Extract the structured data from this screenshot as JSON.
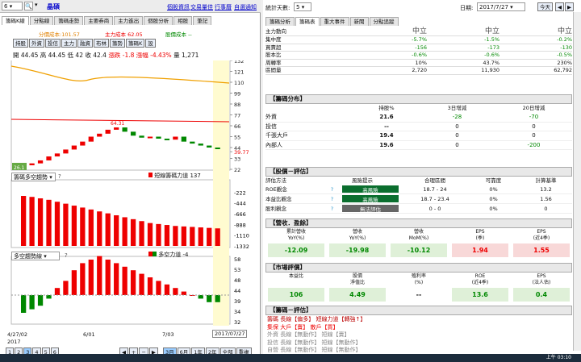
{
  "left": {
    "stock_code": "6",
    "stock_name": "晶碩",
    "links": [
      "個股資訊",
      "交易量佳",
      "行事曆",
      "自選通知"
    ],
    "tabs": [
      "籌碼K線",
      "分點線",
      "籌碼走勢",
      "主要券商",
      "主力進出",
      "個股分析",
      "相股",
      "筆記"
    ],
    "ma_labels": {
      "a": "分價成本:101.57",
      "b": "主力成本 62.05",
      "c": "股價成本 --"
    },
    "buttons": [
      "持股",
      "外資",
      "投信",
      "主力",
      "融資",
      "布林",
      "籌勢",
      "籌碼K",
      "設"
    ],
    "ohlc": {
      "open_label": "開",
      "open": "44.45",
      "high_label": "高",
      "high": "44.45",
      "low_label": "低",
      "low": "42",
      "close_label": "收",
      "close": "42.4",
      "chg_label": "漲跌",
      "chg": "-1.8",
      "pct_label": "漲幅",
      "pct": "-4.43%",
      "vol_label": "量",
      "vol": "1,271"
    },
    "price_axis": [
      "132",
      "121",
      "110",
      "99",
      "88",
      "77",
      "66",
      "55",
      "44",
      "39.77",
      "33",
      "22"
    ],
    "peak_label": "64.31",
    "low_label": "26.1",
    "panel2_select": "籌碼多空趨勢",
    "panel2_legend": "短線籌碼力道 137",
    "panel2_axis": [
      "-222",
      "-444",
      "-666",
      "-888",
      "-1110",
      "-1332"
    ],
    "panel3_select": "多空趨勢線",
    "panel3_legend": "多空力道 -4",
    "panel3_axis": [
      "58",
      "53",
      "48",
      "44",
      "39",
      "34",
      "32"
    ],
    "x_labels": [
      "4/27/02",
      "6/01",
      "7/03",
      "2017/07/27"
    ],
    "year": "2017",
    "pages": [
      "1",
      "2",
      "3",
      "4",
      "5",
      "6"
    ],
    "ranges": [
      "3月",
      "6月",
      "1年",
      "2年",
      "全部",
      "重複"
    ]
  },
  "chart_data": [
    {
      "type": "bar",
      "title": "",
      "series": [
        {
          "name": "價格K線",
          "values": [
            26.1,
            28,
            31,
            35,
            38,
            42,
            46,
            50,
            55,
            58,
            62,
            64.31,
            60,
            56,
            54,
            55,
            53,
            52,
            55,
            50,
            48,
            46,
            44,
            42.4
          ]
        }
      ],
      "ylim": [
        22,
        132
      ]
    },
    {
      "type": "bar",
      "title": "",
      "series": [
        {
          "name": "短線籌碼力道",
          "values": [
            -300,
            -320,
            -350,
            -380,
            -420,
            -460,
            -500,
            -540,
            -580,
            -620,
            -660,
            -700,
            -740,
            -780,
            -820,
            -860,
            -880,
            -900,
            -920,
            -930,
            -940,
            -950,
            -960,
            -970
          ]
        }
      ],
      "ylim": [
        -1332,
        0
      ]
    },
    {
      "type": "bar",
      "title": "",
      "series": [
        {
          "name": "多空力道",
          "values": [
            -10,
            -8,
            -6,
            -2,
            4,
            8,
            14,
            18,
            20,
            22,
            20,
            18,
            16,
            14,
            12,
            10,
            8,
            6,
            4,
            2,
            0,
            -2,
            -4,
            -4
          ]
        }
      ],
      "ylim": [
        -20,
        30
      ]
    }
  ],
  "right": {
    "days_label": "統計天數:",
    "days": "5",
    "date_label": "日期:",
    "date": "2017/7/27",
    "today": "今天",
    "tabs": [
      "籌碼分析",
      "籌碼表",
      "重大事件",
      "新聞",
      "分點追蹤"
    ],
    "summary_rows": [
      {
        "label": "主力動向",
        "c1": "中立",
        "c2": "中立",
        "c3": "中立",
        "cls": "big"
      },
      {
        "label": "集中度",
        "c1": "-5.7%",
        "c2": "-1.5%",
        "c3": "-0.2%",
        "cls": "green"
      },
      {
        "label": "買賣超",
        "c1": "-156",
        "c2": "-173",
        "c3": "-130",
        "cls": "green"
      },
      {
        "label": "股本比",
        "c1": "-0.6%",
        "c2": "-0.6%",
        "c3": "-0.5%",
        "cls": "green"
      },
      {
        "label": "周轉率",
        "c1": "10%",
        "c2": "43.7%",
        "c3": "230%",
        "cls": ""
      },
      {
        "label": "區間量",
        "c1": "2,720",
        "c2": "11,930",
        "c3": "62,792",
        "cls": ""
      }
    ],
    "dist_title": "【籌碼分布】",
    "dist_header": [
      "持股%",
      "3日增減",
      "20日增減"
    ],
    "dist_rows": [
      [
        "外資",
        "21.6",
        "-28",
        "-70"
      ],
      [
        "投信",
        "--",
        "0",
        "0"
      ],
      [
        "千張大戶",
        "19.4",
        "0",
        "0"
      ],
      [
        "內部人",
        "19.6",
        "0",
        "-200"
      ]
    ],
    "val_title": "【股價－評估】",
    "val_header": [
      "評估方法",
      "風險提示",
      "合理區間",
      "可靠度",
      "計算基準"
    ],
    "val_rows": [
      [
        "ROE觀念",
        "?",
        "高風險",
        "18.7 - 24",
        "0%",
        "13.2"
      ],
      [
        "本益比觀念",
        "?",
        "高風險",
        "18.7 - 23.4",
        "0%",
        "1.56"
      ],
      [
        "股利觀念",
        "?",
        "無法評估",
        "0 - 0",
        "0%",
        "0"
      ]
    ],
    "rev_title": "【營收．盈餘】",
    "rev_header": [
      "累計營收\nYoY(%)",
      "營收\nYoY(%)",
      "營收\nMoM(%)",
      "EPS\n(季)",
      "EPS\n(近4季)"
    ],
    "rev_values": [
      "-12.09",
      "-19.98",
      "-10.12",
      "1.94",
      "1.55"
    ],
    "mkt_title": "【市場評價】",
    "mkt_header": [
      "本益比",
      "股價\n淨值比",
      "殖利率\n(%)",
      "ROE\n(近4季)",
      "EPS\n(法人估)"
    ],
    "mkt_values": [
      "106",
      "4.49",
      "--",
      "13.6",
      "0.4"
    ],
    "eval_title": "【籌碼－評估】",
    "eval_lines": [
      "籌碼 長線【偏多】 短線力道【轉強↑】",
      "集保 大戶【賣】 散戶【買】",
      "外資 長線【無動作】 短線【賣】",
      "投信 長線【無動作】 短線【無動作】",
      "自營 長線【無動作】 短線【無動作】"
    ]
  },
  "status_time": "上午 03:10"
}
